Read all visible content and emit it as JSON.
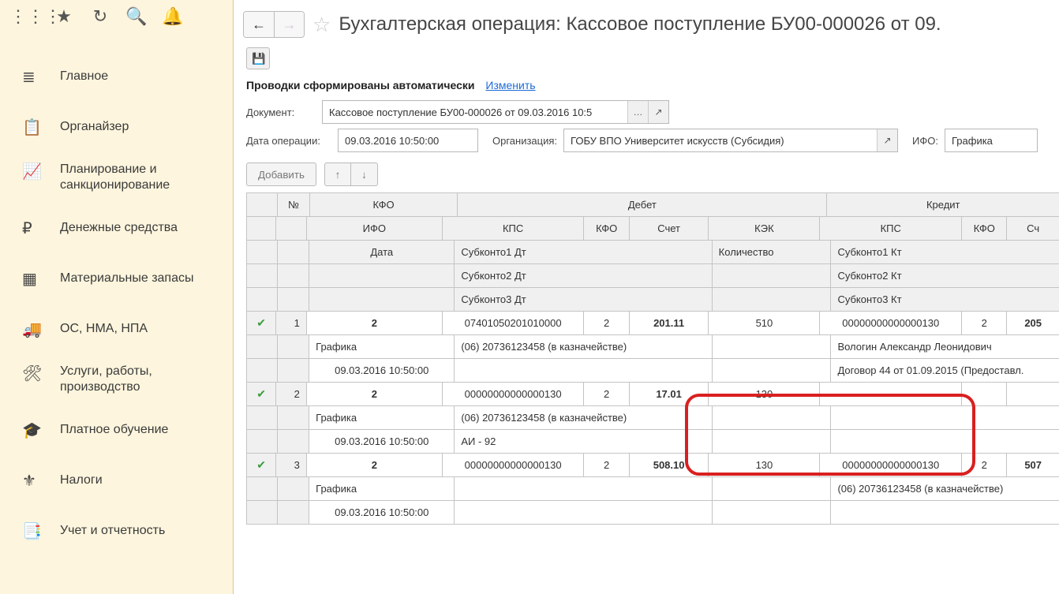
{
  "nav": {
    "items": [
      {
        "label": "Главное"
      },
      {
        "label": "Органайзер"
      },
      {
        "label": "Планирование и санкционирование"
      },
      {
        "label": "Денежные средства"
      },
      {
        "label": "Материальные запасы"
      },
      {
        "label": "ОС, НМА, НПА"
      },
      {
        "label": "Услуги, работы, производство"
      },
      {
        "label": "Платное обучение"
      },
      {
        "label": "Налоги"
      },
      {
        "label": "Учет и отчетность"
      }
    ]
  },
  "header": {
    "title": "Бухгалтерская операция: Кассовое поступление БУ00-000026 от 09."
  },
  "status": {
    "text": "Проводки сформированы автоматически",
    "link": "Изменить"
  },
  "form": {
    "doc_label": "Документ:",
    "doc_value": "Кассовое поступление БУ00-000026 от 09.03.2016 10:5",
    "date_label": "Дата операции:",
    "date_value": "09.03.2016 10:50:00",
    "org_label": "Организация:",
    "org_value": "ГОБУ ВПО Университет искусств (Субсидия)",
    "ifo_label": "ИФО:",
    "ifo_value": "Графика"
  },
  "toolbar": {
    "add": "Добавить"
  },
  "grid_headers": {
    "no": "№",
    "kfo": "КФО",
    "debit": "Дебет",
    "credit": "Кредит",
    "ifo": "ИФО",
    "kps": "КПС",
    "kfo2": "КФО",
    "sch": "Счет",
    "kek": "КЭК",
    "sch2": "Сч",
    "date": "Дата",
    "sub1d": "Субконто1 Дт",
    "kol": "Количество",
    "sub1k": "Субконто1 Кт",
    "sub2d": "Субконто2 Дт",
    "sub2k": "Субконто2 Кт",
    "sub3d": "Субконто3 Дт",
    "sub3k": "Субконто3 Кт"
  },
  "rows": [
    {
      "no": "1",
      "kfo": "2",
      "kps": "07401050201010000",
      "kfo2": "2",
      "sch": "201.11",
      "kek": "510",
      "kps2": "00000000000000130",
      "kfo3": "2",
      "sch2": "205",
      "ifo": "Графика",
      "sub1d": "(06) 20736123458 (в казначействе)",
      "sub1k": "Вологин Александр Леонидович",
      "date": "09.03.2016 10:50:00",
      "sub2k": "Договор 44 от 01.09.2015 (Предоставл.",
      "selected": true
    },
    {
      "no": "2",
      "kfo": "2",
      "kps": "00000000000000130",
      "kfo2": "2",
      "sch": "17.01",
      "kek": "130",
      "ifo": "Графика",
      "sub1d": "(06) 20736123458 (в казначействе)",
      "date": "09.03.2016 10:50:00",
      "sub2d": "АИ - 92"
    },
    {
      "no": "3",
      "kfo": "2",
      "kps": "00000000000000130",
      "kfo2": "2",
      "sch": "508.10",
      "kek": "130",
      "kps2": "00000000000000130",
      "kfo3": "2",
      "sch2": "507",
      "ifo": "Графика",
      "sub1d": "(06) 20736123458 (в казначействе)",
      "date": "09.03.2016 10:50:00"
    }
  ]
}
